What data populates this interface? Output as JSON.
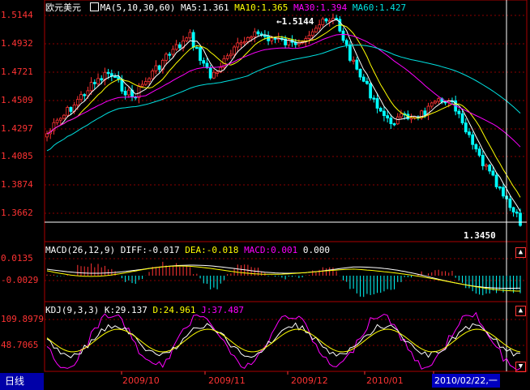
{
  "header": {
    "symbol": "欧元美元",
    "ma_label": "MA(5,10,30,60)",
    "ma5": "MA5:1.361",
    "ma10": "MA10:1.365",
    "ma30": "MA30:1.394",
    "ma60": "MA60:1.427"
  },
  "colors": {
    "up": "#ff3333",
    "down": "#00ffff",
    "ma5": "#ffffff",
    "ma10": "#ffff00",
    "ma30": "#ff00ff",
    "ma60": "#00e0e0",
    "grid": "#8b0000"
  },
  "price_axis": [
    "1.5144",
    "1.4932",
    "1.4721",
    "1.4509",
    "1.4297",
    "1.4085",
    "1.3874",
    "1.3662"
  ],
  "price_high_label": "1.5144",
  "price_low_label": "1.3450",
  "macd": {
    "label": "MACD(26,12,9)",
    "diff": "DIFF:-0.017",
    "dea": "DEA:-0.018",
    "macd": "MACD:0.001",
    "extra": "0.000",
    "axis": [
      "0.0135",
      "-0.0029"
    ]
  },
  "kdj": {
    "label": "KDJ(9,3,3)",
    "k": "K:29.137",
    "d": "D:24.961",
    "j": "J:37.487",
    "axis": [
      "109.8979",
      "48.7065"
    ]
  },
  "footer": {
    "period_tab": "日线",
    "dates": [
      "2009/10",
      "2009/11",
      "2009/12",
      "2010/01"
    ],
    "cursor_date": "2010/02/22,一"
  }
}
